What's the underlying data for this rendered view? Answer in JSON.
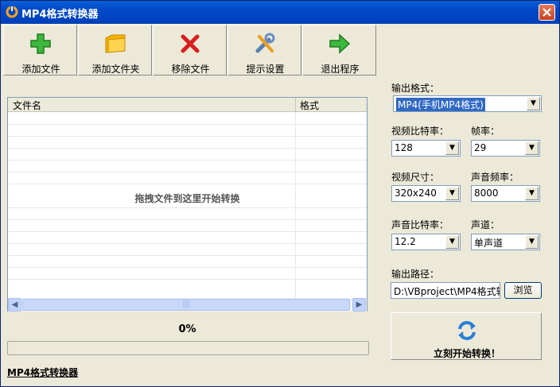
{
  "window": {
    "title": "MP4格式转换器"
  },
  "toolbar": {
    "buttons": [
      {
        "label": "添加文件",
        "icon": "add-plus-icon"
      },
      {
        "label": "添加文件夹",
        "icon": "folder-icon"
      },
      {
        "label": "移除文件",
        "icon": "remove-x-icon"
      },
      {
        "label": "提示设置",
        "icon": "tools-icon"
      },
      {
        "label": "退出程序",
        "icon": "exit-arrow-icon"
      }
    ]
  },
  "file_list": {
    "columns": [
      "文件名",
      "格式"
    ],
    "drop_hint": "拖拽文件到这里开始转换"
  },
  "progress": {
    "text": "0%",
    "value": 0
  },
  "footer": {
    "link": "MP4格式转换器"
  },
  "settings": {
    "output_format_label": "输出格式：",
    "output_format_value": "MP4(手机MP4格式)",
    "video_bitrate_label": "视频比特率：",
    "video_bitrate_value": "128",
    "frame_rate_label": "帧率：",
    "frame_rate_value": "29",
    "video_size_label": "视频尺寸：",
    "video_size_value": "320x240",
    "audio_freq_label": "声音频率：",
    "audio_freq_value": "8000",
    "audio_bitrate_label": "声音比特率：",
    "audio_bitrate_value": "12.2",
    "channel_label": "声道：",
    "channel_value": "单声道",
    "output_path_label": "输出路径：",
    "output_path_value": "D:\\VBproject\\MP4格式转",
    "browse_label": "浏览",
    "start_label": "立刻开始转换！"
  },
  "colors": {
    "titlebar": "#0048c8",
    "selection": "#316ac5",
    "progress": "#2fb12f"
  }
}
